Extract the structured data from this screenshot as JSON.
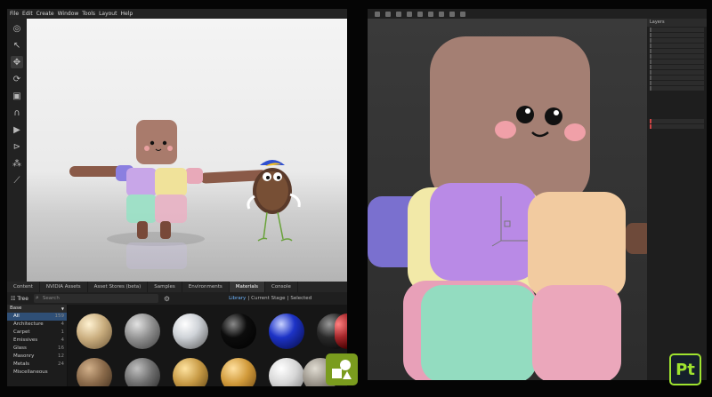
{
  "left_app": {
    "menu": [
      "File",
      "Edit",
      "Create",
      "Window",
      "Tools",
      "Layout",
      "Help"
    ],
    "panel_tabs": [
      "Content",
      "NVIDIA Assets",
      "Asset Stores (beta)",
      "Samples",
      "Environments",
      "Materials",
      "Console"
    ],
    "active_tab": "Materials",
    "tree_label": "Tree",
    "search_placeholder": "Search",
    "library_tabs": {
      "library": "Library",
      "current_stage": "Current Stage",
      "selected": "Selected"
    },
    "sidebar": {
      "header": "Base",
      "items": [
        {
          "label": "All",
          "count": "159"
        },
        {
          "label": "Architecture",
          "count": "4"
        },
        {
          "label": "Carpet",
          "count": "1"
        },
        {
          "label": "Emissives",
          "count": "4"
        },
        {
          "label": "Glass",
          "count": "16"
        },
        {
          "label": "Masonry",
          "count": "12"
        },
        {
          "label": "Metals",
          "count": "24"
        },
        {
          "label": "Miscellaneous",
          "count": ""
        }
      ]
    },
    "materials_colors": [
      "#c9ad7e",
      "#8f8f8f",
      "#cfd3d8",
      "#0c0c0c",
      "#1d33c7",
      "#2a2a2a",
      "#a4262a",
      "#8a6a4a",
      "#6e6e6e",
      "#c79a45",
      "#d19a3a",
      "#d6d6d6",
      "#9a948a"
    ]
  },
  "right_app": {
    "panel_header": "Layers"
  },
  "logos": {
    "pt_label": "Pt"
  }
}
